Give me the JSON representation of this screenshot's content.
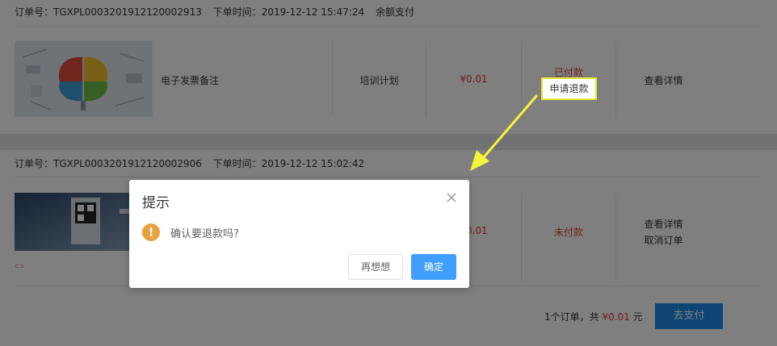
{
  "orders": [
    {
      "order_no": "订单号：TGXPL0003201912120002913",
      "order_time": "下单时间：2019-12-12 15:47:24",
      "pay_method": "余额支付",
      "product_name": "电子发票备注",
      "category": "培训计划",
      "price": "¥0.01",
      "status": "已付款",
      "refund_label": "申请退款",
      "actions": [
        "查看详情"
      ]
    },
    {
      "order_no": "订单号：TGXPL0003201912120002906",
      "order_time": "下单时间：2019-12-12 15:02:42",
      "price": "¥0.01",
      "status": "未付款",
      "actions": [
        "查看详情",
        "取消订单"
      ]
    }
  ],
  "summary": {
    "prefix": "1个订单，共",
    "amount": "¥0.01",
    "suffix": "元",
    "pay_label": "去支付"
  },
  "dialog": {
    "title": "提示",
    "icon": "warning-icon",
    "message": "确认要退款吗?",
    "cancel_label": "再想想",
    "confirm_label": "确定"
  },
  "colors": {
    "highlight": "#e8e830",
    "price_red": "#e4393c",
    "primary": "#409eff",
    "pay_blue": "#1b8be8",
    "warning": "#e6a23c"
  }
}
